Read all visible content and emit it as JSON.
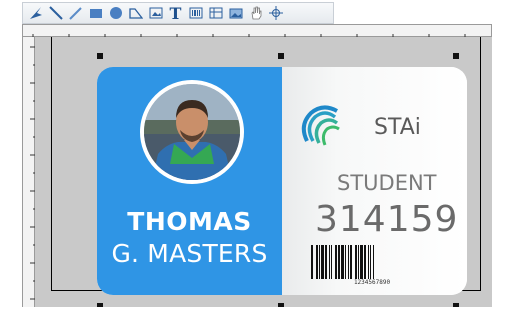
{
  "toolbar": {
    "tools": [
      {
        "icon": "select-arrow-icon"
      },
      {
        "icon": "line-icon"
      },
      {
        "icon": "pen-icon"
      },
      {
        "icon": "rectangle-icon"
      },
      {
        "icon": "ellipse-icon"
      },
      {
        "icon": "polygon-icon"
      },
      {
        "icon": "image-icon"
      },
      {
        "icon": "text-icon",
        "label": "T"
      },
      {
        "icon": "barcode-icon"
      },
      {
        "icon": "database-icon"
      },
      {
        "icon": "picture-icon"
      },
      {
        "icon": "hand-pan-icon"
      },
      {
        "icon": "zoom-crosshair-icon"
      }
    ]
  },
  "badge": {
    "first_name": "THOMAS",
    "last_name": "G. MASTERS",
    "organization": "STAi",
    "role": "STUDENT",
    "id_number": "314159",
    "barcode_value": "1234567890",
    "colors": {
      "accent_blue": "#2f95e5",
      "logo_blue": "#1e88c9",
      "logo_green": "#3dbb6b"
    }
  }
}
